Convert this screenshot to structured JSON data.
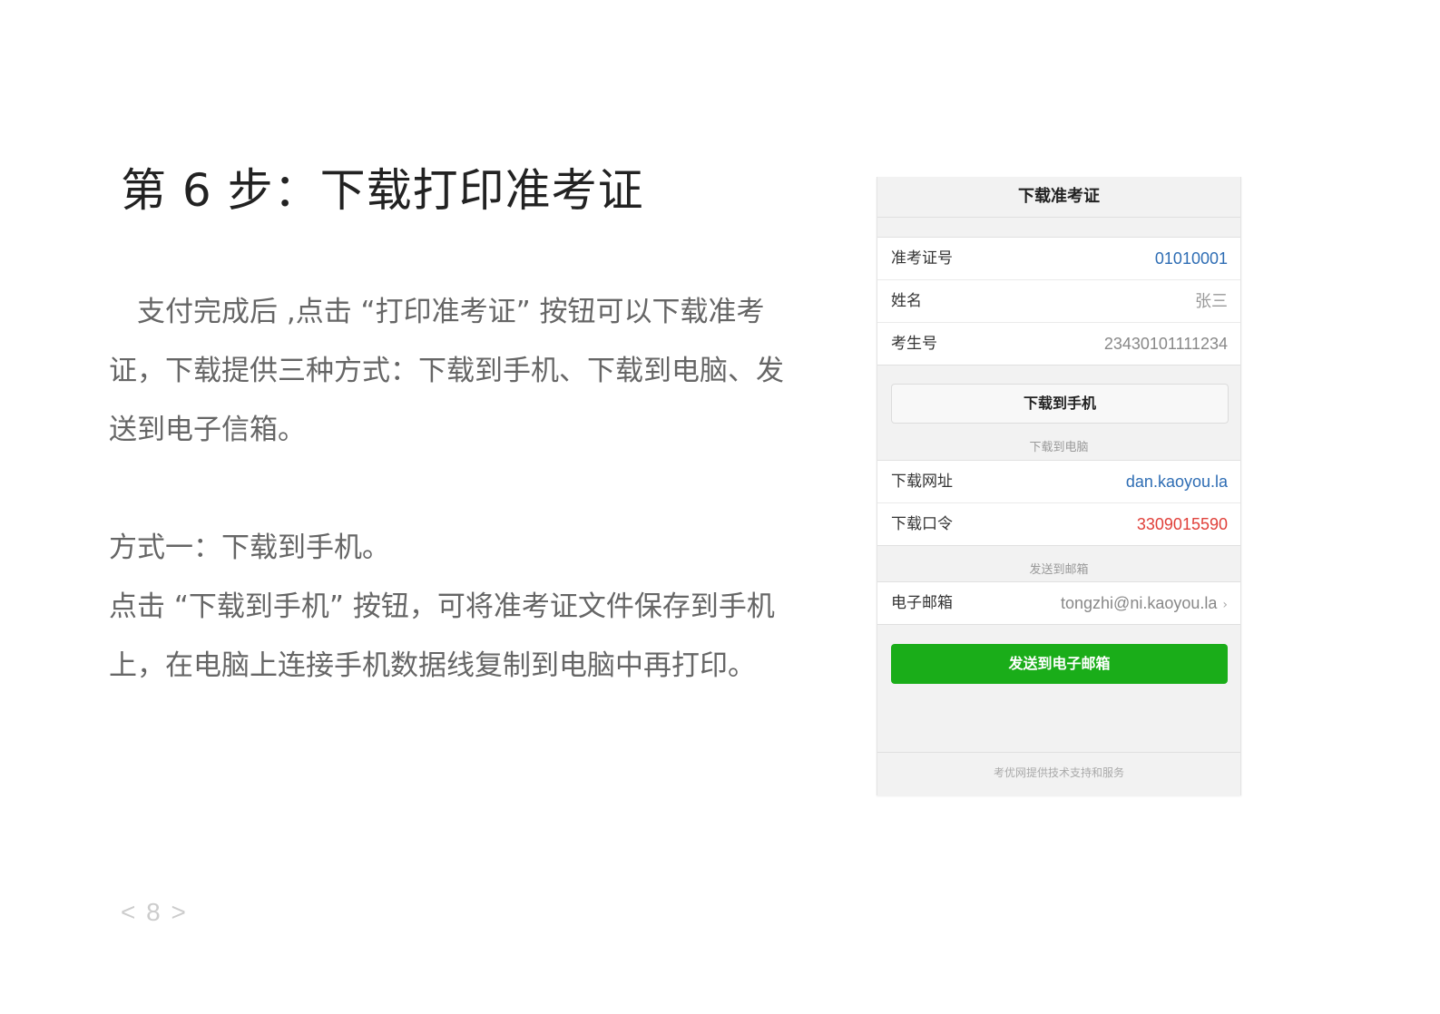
{
  "title": "第 6 步：下载打印准考证",
  "paragraphs": {
    "intro_line1": "支付完成后 ,点击 “打印准考证” 按钮可以下载准考",
    "intro_line2": "证，下载提供三种方式：下载到手机、下载到电脑、发",
    "intro_line3": "送到电子信箱。",
    "method_line": "方式一：下载到手机。",
    "detail_line1": "点击 “下载到手机” 按钮，可将准考证文件保存到手机",
    "detail_line2": "上，在电脑上连接手机数据线复制到电脑中再打印。"
  },
  "page_number": "< 8 >",
  "phone": {
    "header_title": "下载准考证",
    "info_rows": [
      {
        "label": "准考证号",
        "value": "01010001"
      },
      {
        "label": "姓名",
        "value": "张三"
      },
      {
        "label": "考生号",
        "value": "23430101111234"
      }
    ],
    "download_phone_button": "下载到手机",
    "computer_caption": "下载到电脑",
    "computer_rows": [
      {
        "label": "下载网址",
        "value": "dan.kaoyou.la"
      },
      {
        "label": "下载口令",
        "value": "3309015590"
      }
    ],
    "email_caption": "发送到邮箱",
    "email_row": {
      "label": "电子邮箱",
      "value": "tongzhi@ni.kaoyou.la"
    },
    "send_button": "发送到电子邮箱",
    "footer": "考优网提供技术支持和服务",
    "colors": {
      "link_blue": "#2e6db4",
      "code_red": "#e0403a",
      "send_green": "#1aad19"
    }
  }
}
